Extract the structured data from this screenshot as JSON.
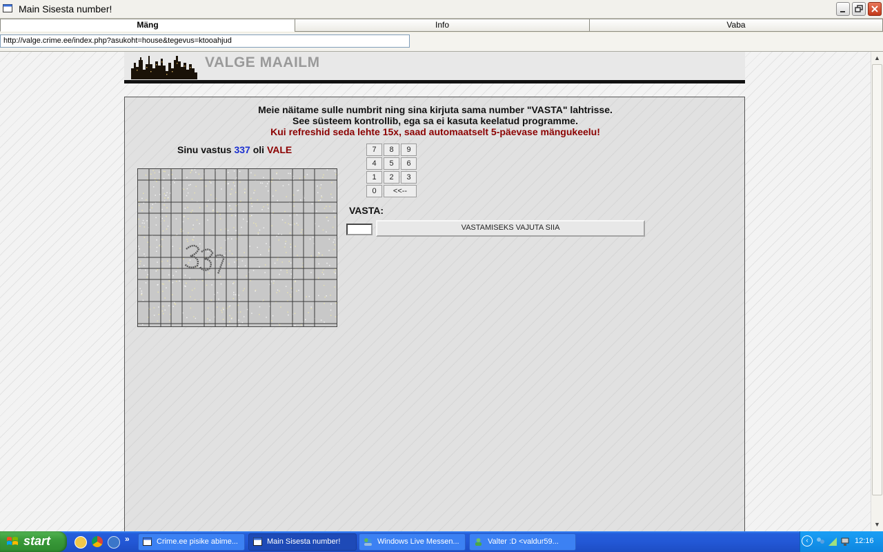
{
  "window": {
    "title": "Main Sisesta number!"
  },
  "tabs": [
    {
      "label": "Mäng",
      "active": true
    },
    {
      "label": "Info",
      "active": false
    },
    {
      "label": "Vaba",
      "active": false
    }
  ],
  "address": {
    "url": "http://valge.crime.ee/index.php?asukoht=house&tegevus=ktooahjud"
  },
  "banner": {
    "logo_text": "VALGE MAAILM"
  },
  "instructions": {
    "line1": "Meie näitame sulle numbrit ning sina kirjuta sama number \"VASTA\" lahtrisse.",
    "line2": "See süsteem kontrollib, ega sa ei kasuta keelatud programme.",
    "warning": "Kui refreshid seda lehte 15x, saad automaatselt 5-päevase mängukeelu!"
  },
  "answer": {
    "prefix": "Sinu vastus",
    "number": "337",
    "middle": "oli",
    "result": "VALE"
  },
  "keypad": {
    "keys": [
      "7",
      "8",
      "9",
      "4",
      "5",
      "6",
      "1",
      "2",
      "3",
      "0"
    ],
    "backspace": "<<--"
  },
  "form": {
    "label": "VASTA:",
    "input_value": "",
    "submit_label": "VASTAMISEKS VAJUTA SIIA"
  },
  "taskbar": {
    "start_label": "start",
    "quicklaunch_more": "»",
    "tasks": [
      {
        "label": "Crime.ee pisike abime...",
        "active": false
      },
      {
        "label": "Main Sisesta number!",
        "active": true
      },
      {
        "label": "Windows Live Messen...",
        "active": false
      },
      {
        "label": "Valter   :D <valdur59...",
        "active": false
      }
    ],
    "tray_chevron": "‹",
    "clock": "12:16"
  }
}
